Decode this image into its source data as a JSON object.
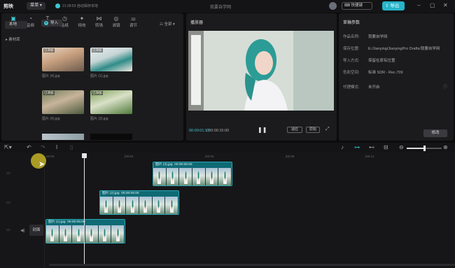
{
  "titlebar": {
    "logo": "剪映",
    "menu": "菜单",
    "autosave": "21:39:53 自动保存本地",
    "project_title": "我要自学网",
    "shortcut": "快捷键",
    "export": "导出"
  },
  "tools": [
    {
      "label": "媒体",
      "icon": "media-icon",
      "glyph": "▣",
      "active": true
    },
    {
      "label": "音频",
      "icon": "audio-icon",
      "glyph": "◔",
      "active": false
    },
    {
      "label": "文本",
      "icon": "text-icon",
      "glyph": "T",
      "active": false
    },
    {
      "label": "贴纸",
      "icon": "sticker-icon",
      "glyph": "◷",
      "active": false
    },
    {
      "label": "特效",
      "icon": "effects-icon",
      "glyph": "✦",
      "active": false
    },
    {
      "label": "转场",
      "icon": "transition-icon",
      "glyph": "⋈",
      "active": false
    },
    {
      "label": "滤镜",
      "icon": "filter-icon",
      "glyph": "◎",
      "active": false
    },
    {
      "label": "调节",
      "icon": "adjust-icon",
      "glyph": "⚌",
      "active": false
    }
  ],
  "media": {
    "side_local": "本地",
    "side_library": "素材库",
    "import": "导入",
    "sort": "全部",
    "thumbs": [
      {
        "label": "图片 (4).jpg",
        "badge": "已添加"
      },
      {
        "label": "图片 (1).jpg",
        "badge": "已添加"
      },
      {
        "label": "图片 (4).jpg",
        "badge": "已添加"
      },
      {
        "label": "图片 (3).jpg",
        "badge": "已添加"
      }
    ]
  },
  "player": {
    "title": "播放器",
    "timecode": "00:00:01:13",
    "duration": "00:00:15:00",
    "fit": "适应",
    "original": "原始"
  },
  "draft": {
    "title": "草稿参数",
    "props": [
      {
        "k": "作品名称:",
        "v": "我要自学网"
      },
      {
        "k": "保存位置:",
        "v": "E:/Jianying/JianyingPro Drafts/我要自学网"
      },
      {
        "k": "导入方式:",
        "v": "保留在原有位置"
      },
      {
        "k": "色彩空间:",
        "v": "标准 SDR - Rec.709"
      },
      {
        "k": "代理模式:",
        "v": "未开启"
      }
    ],
    "edit": "修改"
  },
  "ruler": [
    "00:00",
    "|00:03",
    "|00:06",
    "|00:09",
    "|00:12"
  ],
  "clips": [
    {
      "name": "图片 (3).jpg",
      "dur": "00:00:05:00"
    },
    {
      "name": "图片 (2).jpg",
      "dur": "00:00:05:00"
    },
    {
      "name": "图片 (1).jpg",
      "dur": "00:00:05:00"
    }
  ],
  "cover": "封面",
  "colors": {
    "accent": "#26b4c9",
    "clip_border": "#2aa7b6",
    "playhead": "#e6e6e6"
  }
}
